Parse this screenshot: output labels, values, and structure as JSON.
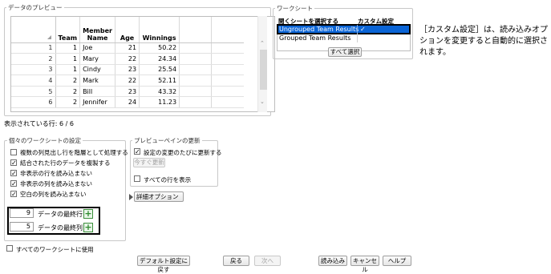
{
  "preview_group": {
    "title": "データのプレビュー"
  },
  "table": {
    "columns": [
      {
        "label": "Team"
      },
      {
        "label": "Member\nName"
      },
      {
        "label": "Age"
      },
      {
        "label": "Winnings"
      }
    ],
    "rows": [
      {
        "n": "1",
        "team": "1",
        "name": "Joe",
        "age": "21",
        "win": "50.22"
      },
      {
        "n": "2",
        "team": "1",
        "name": "Mary",
        "age": "22",
        "win": "24.34"
      },
      {
        "n": "3",
        "team": "1",
        "name": "Cindy",
        "age": "23",
        "win": "25.54"
      },
      {
        "n": "4",
        "team": "2",
        "name": "Mark",
        "age": "22",
        "win": "52.11"
      },
      {
        "n": "5",
        "team": "2",
        "name": "Bill",
        "age": "23",
        "win": "43.32"
      },
      {
        "n": "6",
        "team": "2",
        "name": "Jennifer",
        "age": "24",
        "win": "11.23"
      }
    ]
  },
  "rows_shown": "表示されている行: 6 / 6",
  "worksheet": {
    "title": "ワークシート",
    "col_open": "開くシートを選択する",
    "col_custom": "カスタム設定",
    "sheets": [
      {
        "name": "Ungrouped Team Results",
        "custom": "✓",
        "selected": true
      },
      {
        "name": "Grouped Team Results",
        "custom": "",
        "selected": false
      }
    ],
    "select_all": "すべて選択"
  },
  "note": "［カスタム設定］は、読み込みオプションを変更すると自動的に選択されます。",
  "individual": {
    "title": "個々のワークシートの設定",
    "options": [
      {
        "label": "複数の列見出し行を階層として処理する",
        "checked": false
      },
      {
        "label": "結合された行のデータを複製する",
        "checked": true
      },
      {
        "label": "非表示の行を読み込まない",
        "checked": true
      },
      {
        "label": "非表示の列を読み込まない",
        "checked": true
      },
      {
        "label": "空白の列を読み込まない",
        "checked": true
      }
    ],
    "last_row_value": "9",
    "last_row_label": "データの最終行",
    "last_col_value": "5",
    "last_col_label": "データの最終列"
  },
  "preview_update": {
    "title": "プレビューペインの更新",
    "update_each": "設定の変更のたびに更新する",
    "update_each_checked": true,
    "update_now": "今すぐ更新",
    "show_all_rows": "すべての行を表示",
    "show_all_rows_checked": false
  },
  "advanced": "詳細オプション",
  "use_all_sheets": "すべてのワークシートに使用",
  "footer": {
    "restore": "デフォルト設定に戻す",
    "back": "戻る",
    "next": "次へ",
    "import": "読み込み",
    "cancel": "キャンセル",
    "help": "ヘルプ"
  }
}
